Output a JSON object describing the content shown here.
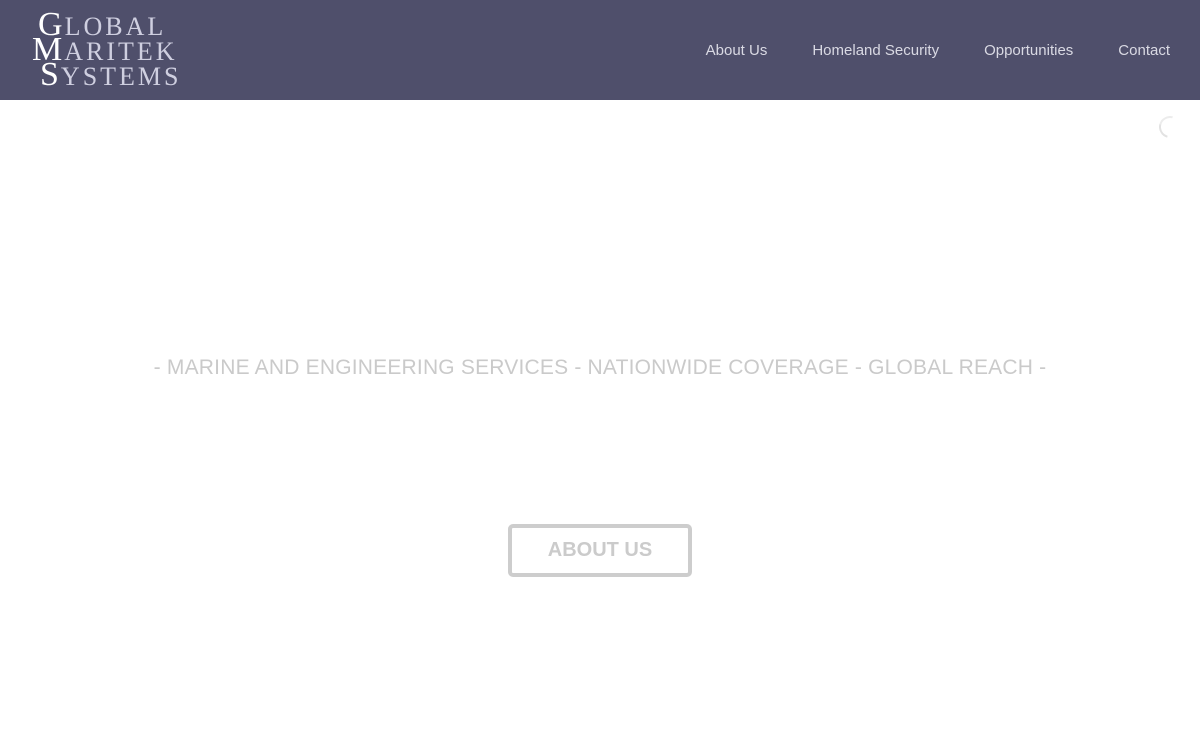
{
  "header": {
    "logo": {
      "line1_cap": "G",
      "line1_rest": "LOBAL",
      "line2_cap": "M",
      "line2_rest": "ARITEK",
      "line3_cap": "S",
      "line3_rest": "YSTEMS"
    },
    "nav": {
      "items": [
        {
          "label": "About Us"
        },
        {
          "label": "Homeland Security"
        },
        {
          "label": "Opportunities"
        },
        {
          "label": "Contact"
        }
      ]
    }
  },
  "hero": {
    "tagline": "- MARINE AND ENGINEERING SERVICES - NATIONWIDE COVERAGE - GLOBAL REACH -",
    "button_label": "ABOUT US"
  },
  "colors": {
    "header_bg": "#4f4f6b",
    "nav_text": "#d9d9e3",
    "hero_text": "#cacaca",
    "button_border": "#cdcdcd"
  },
  "icons": {
    "loading": "loading-spinner-icon"
  }
}
